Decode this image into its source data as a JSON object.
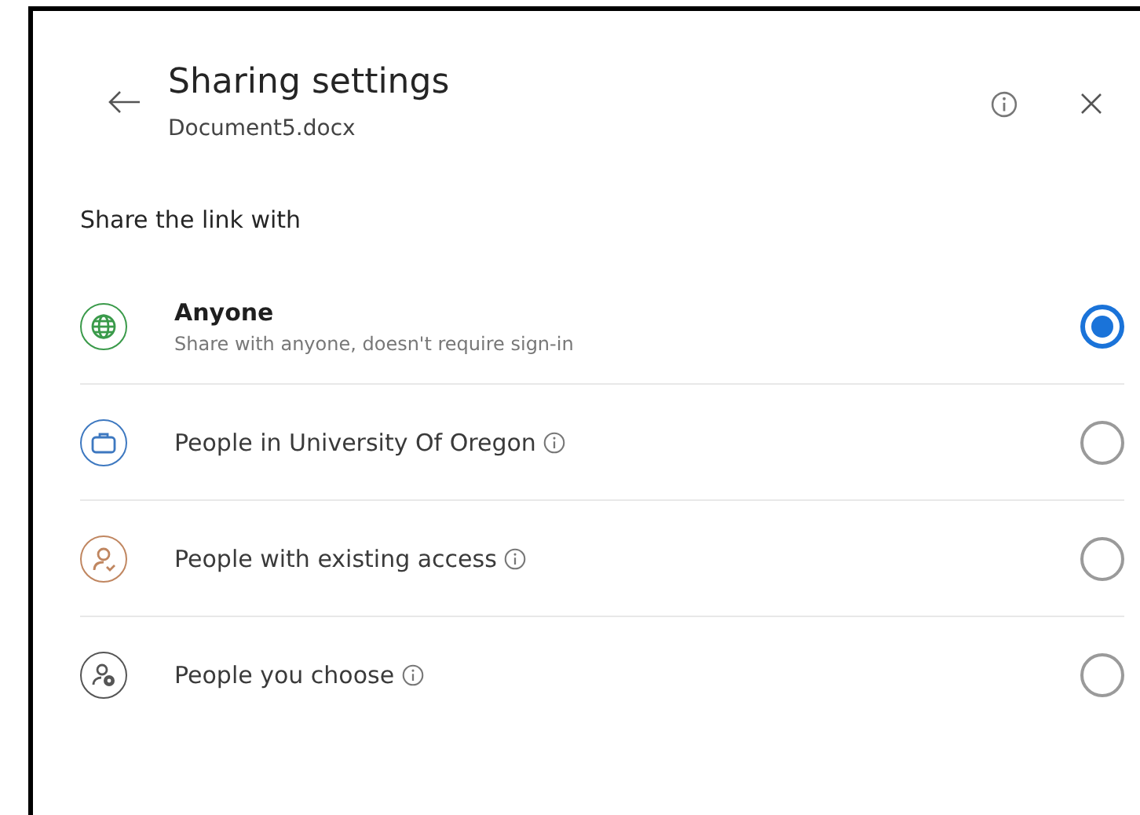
{
  "header": {
    "title": "Sharing settings",
    "subtitle": "Document5.docx"
  },
  "section_label": "Share the link with",
  "options": [
    {
      "kind": "globe",
      "color": "#3a9a4a",
      "label": "Anyone",
      "description": "Share with anyone, doesn't require sign-in",
      "info": false,
      "selected": true
    },
    {
      "kind": "briefcase",
      "color": "#3d78c0",
      "label": "People in University Of Oregon",
      "info": true,
      "selected": false
    },
    {
      "kind": "person-arrow",
      "color": "#c08660",
      "label": "People with existing access",
      "info": true,
      "selected": false
    },
    {
      "kind": "person-add",
      "color": "#555555",
      "label": "People you choose",
      "info": true,
      "selected": false
    }
  ]
}
